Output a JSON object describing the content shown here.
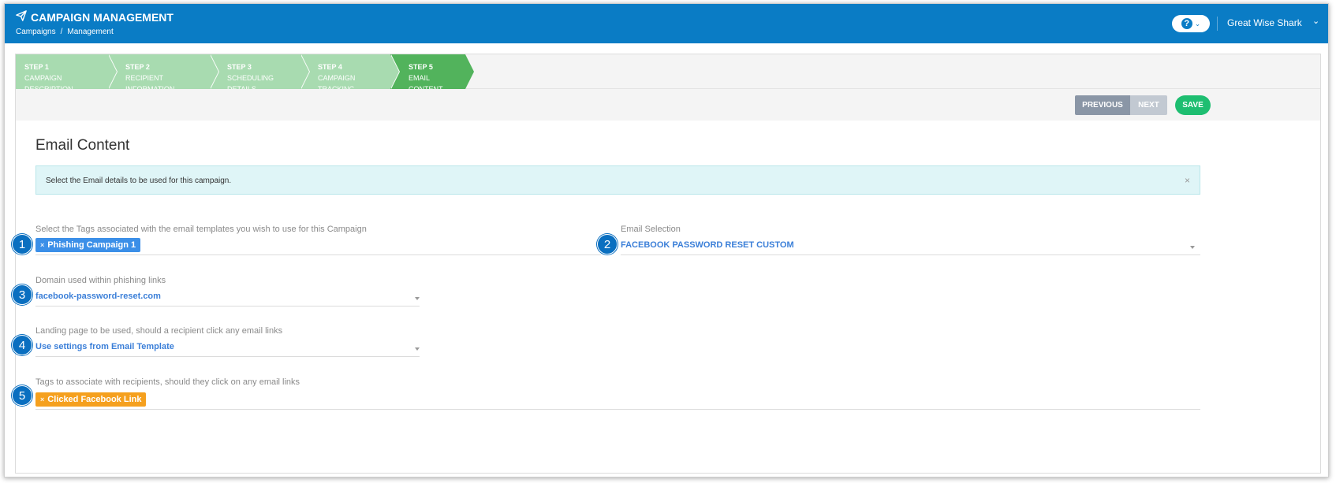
{
  "app": {
    "title": "CAMPAIGN MANAGEMENT",
    "breadcrumb": [
      "Campaigns",
      "/",
      "Management"
    ],
    "help_label": "?",
    "user_name": "Great Wise Shark"
  },
  "wizard": {
    "steps": [
      {
        "num": "STEP 1",
        "label": "CAMPAIGN DESCRIPTION",
        "state": "done"
      },
      {
        "num": "STEP 2",
        "label": "RECIPIENT INFORMATION",
        "state": "done"
      },
      {
        "num": "STEP 3",
        "label": "SCHEDULING DETAILS",
        "state": "done"
      },
      {
        "num": "STEP 4",
        "label": "CAMPAIGN TRACKING",
        "state": "done"
      },
      {
        "num": "STEP 5",
        "label": "EMAIL CONTENT",
        "state": "active"
      }
    ],
    "previous_label": "PREVIOUS",
    "next_label": "NEXT",
    "save_label": "SAVE"
  },
  "content": {
    "title": "Email Content",
    "info_text": "Select the Email details to be used for this campaign.",
    "info_close": "×",
    "tags_label": "Select the Tags associated with the email templates you wish to use for this Campaign",
    "tags": [
      "Phishing Campaign 1"
    ],
    "email_label": "Email Selection",
    "email_value": "FACEBOOK PASSWORD RESET CUSTOM",
    "domain_label": "Domain used within phishing links",
    "domain_value": "facebook-password-reset.com",
    "landing_label": "Landing page to be used, should a recipient click any email links",
    "landing_value": "Use settings from Email Template",
    "click_tags_label": "Tags to associate with recipients, should they click on any email links",
    "click_tags": [
      "Clicked Facebook Link"
    ],
    "tag_remove": "×"
  },
  "callouts": [
    "1",
    "2",
    "3",
    "4",
    "5"
  ],
  "colors": {
    "header": "#0a7cc5",
    "step_done": "#a8dbb0",
    "step_active": "#52b35c",
    "save": "#1ebe71",
    "tag_blue": "#3b8fe8",
    "tag_orange": "#f5a01e",
    "callout": "#0a6fc0"
  }
}
